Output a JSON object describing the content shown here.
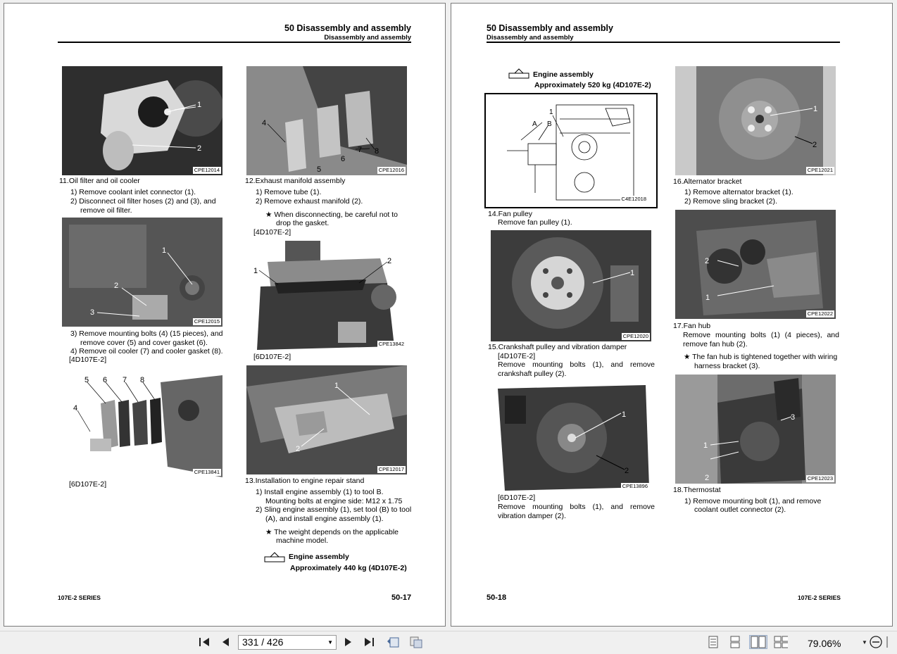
{
  "left_page": {
    "header": {
      "title": "50 Disassembly and assembly",
      "subtitle": "Disassembly and assembly"
    },
    "img_codes": {
      "a": "CPE12014",
      "b": "CPE12015",
      "c": "CPE13841",
      "d": "CPE12016",
      "e": "CPE13842",
      "f": "CPE12017"
    },
    "callouts": {
      "a": [
        "1",
        "2"
      ],
      "b": [
        "1",
        "2",
        "3"
      ],
      "c": [
        "5",
        "6",
        "7",
        "8",
        "4"
      ],
      "d": [
        "4",
        "7",
        "8",
        "6",
        "5"
      ],
      "e": [
        "1",
        "2"
      ],
      "f": [
        "1",
        "2"
      ]
    },
    "s11_title": "11.Oil filter and oil cooler",
    "s11_1": "1)  Remove coolant inlet connector (1).",
    "s11_2a": "2)  Disconnect oil filter hoses (2) and (3), and",
    "s11_2b": "remove oil filter.",
    "s11_3a": "3)  Remove mounting bolts (4) (15 pieces), and",
    "s11_3b": "remove cover (5) and cover gasket (6).",
    "s11_4": "4)  Remove oil cooler (7) and cooler gasket (8).",
    "s11_tag1": "[4D107E-2]",
    "s11_tag2": "[6D107E-2]",
    "s12_title": "12.Exhaust manifold assembly",
    "s12_1": "1)  Remove tube (1).",
    "s12_2": "2)  Remove exhaust manifold (2).",
    "s12_note_a": "★  When disconnecting, be careful not to",
    "s12_note_b": "drop the gasket.",
    "s12_tag1": "[4D107E-2]",
    "s12_tag2": "[6D107E-2]",
    "s13_title": "13.Installation to engine repair stand",
    "s13_1a": "1)  Install engine assembly (1) to tool B.",
    "s13_1b": "Mounting bolts at engine side: M12 x 1.75",
    "s13_2a": "2)  Sling engine assembly (1), set tool (B) to tool",
    "s13_2b": "(A), and install engine assembly (1).",
    "s13_note_a": "★  The weight depends on the applicable",
    "s13_note_b": "machine model.",
    "weight_label": "Engine assembly",
    "weight_value": "Approximately 440 kg (4D107E-2)",
    "footer": "107E-2 SERIES",
    "page_number": "50-17"
  },
  "right_page": {
    "header": {
      "title": "50 Disassembly and assembly",
      "subtitle": "Disassembly and assembly"
    },
    "weight_label": "Engine assembly",
    "weight_value": "Approximately 520 kg (4D107E-2)",
    "img_codes": {
      "diagram": "C4E12018",
      "fan": "CPE12020",
      "crank": "CPE13896",
      "alt": "CPE12021",
      "fanhub": "CPE12022",
      "thermo": "CPE12023"
    },
    "callouts": {
      "diagram": [
        "1",
        "A",
        "B"
      ],
      "fan": [
        "1"
      ],
      "crank": [
        "1",
        "2"
      ],
      "alt": [
        "1",
        "2"
      ],
      "fanhub": [
        "2",
        "1"
      ],
      "thermo": [
        "3",
        "1",
        "2"
      ]
    },
    "s14_title": "14.Fan pulley",
    "s14_1": "Remove fan pulley (1).",
    "s15_title": "15.Crankshaft pulley and vibration damper",
    "s15_tag1": "[4D107E-2]",
    "s15_text1": "Remove mounting bolts (1), and remove crankshaft pulley (2).",
    "s15_tag2": "[6D107E-2]",
    "s15_text2": "Remove mounting bolts (1), and remove vibration damper (2).",
    "s16_title": "16.Alternator bracket",
    "s16_1": "1)  Remove alternator bracket (1).",
    "s16_2": "2)  Remove sling bracket (2).",
    "s17_title": "17.Fan hub",
    "s17_text": "Remove mounting bolts (1) (4 pieces), and remove fan hub (2).",
    "s17_note_a": "★  The fan hub is tightened together with wiring",
    "s17_note_b": "harness bracket (3).",
    "s18_title": "18.Thermostat",
    "s18_1a": "1)  Remove mounting bolt (1), and remove",
    "s18_1b": "coolant outlet connector (2).",
    "footer": "107E-2 SERIES",
    "page_number": "50-18"
  },
  "toolbar": {
    "page_input": "331 / 426",
    "zoom": "79.06%",
    "buttons": [
      "first-page-icon",
      "prev-page-icon",
      "next-page-icon",
      "last-page-icon",
      "rotate-icon",
      "compare-icon",
      "single-page-icon",
      "continuous-icon",
      "two-page-icon",
      "two-page-continuous-icon",
      "zoom-out-icon"
    ]
  }
}
